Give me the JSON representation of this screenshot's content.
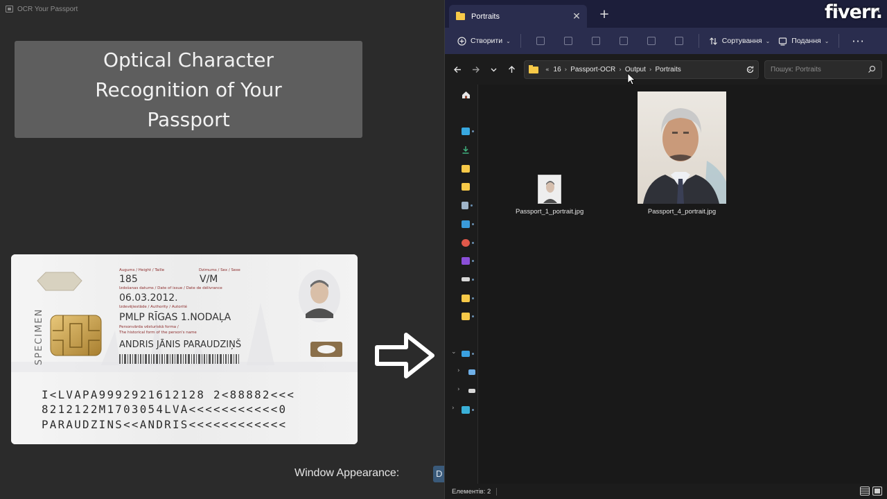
{
  "left_app": {
    "window_title": "OCR Your Passport",
    "heading": "Optical Character Recognition of Your Passport",
    "window_appearance_label": "Window Appearance:",
    "appearance_value": "D",
    "passport": {
      "specimen": "SPECIMEN",
      "height_label": "Augums / Height / Taille",
      "sex_label": "Dzimums / Sex / Sexe",
      "height_value": "185",
      "sex_value": "V/M",
      "issue_label": "Izdošanas datums / Date of issue / Date de délivrance",
      "issue_value": "06.03.2012.",
      "authority_label": "Izdevējiestāde / Authority / Autorité",
      "authority_value": "PMLP RĪGAS 1.NODAĻA",
      "historical_label_1": "Personvārda vēsturiskā forma /",
      "historical_label_2": "The historical form of the person's name",
      "name_value": "ANDRIS JĀNIS PARAUDZIŅŠ",
      "mrz": [
        "I<LVAPA9992921612128 2<88882<<<",
        "8212122M1703054LVA<<<<<<<<<<<0",
        "PARAUDZINS<<ANDRIS<<<<<<<<<<<<"
      ]
    }
  },
  "explorer": {
    "tab_label": "Portraits",
    "tab_close": "✕",
    "new_tab": "+",
    "watermark": "fiverr.",
    "toolbar": {
      "create_label": "Створити",
      "sort_label": "Сортування",
      "view_label": "Подання",
      "more": "···"
    },
    "breadcrumb": [
      "16",
      "Passport-OCR",
      "Output",
      "Portraits"
    ],
    "search_placeholder": "Пошук: Portraits",
    "files": [
      {
        "name": "Passport_1_portrait.jpg"
      },
      {
        "name": "Passport_4_portrait.jpg"
      }
    ],
    "status_items": "Елементів: 2"
  },
  "colors": {
    "tab_bar": "#1c1e3a",
    "toolbar": "#2a2d4e",
    "folder": "#f7c948",
    "title_box": "#5e5e5e"
  }
}
